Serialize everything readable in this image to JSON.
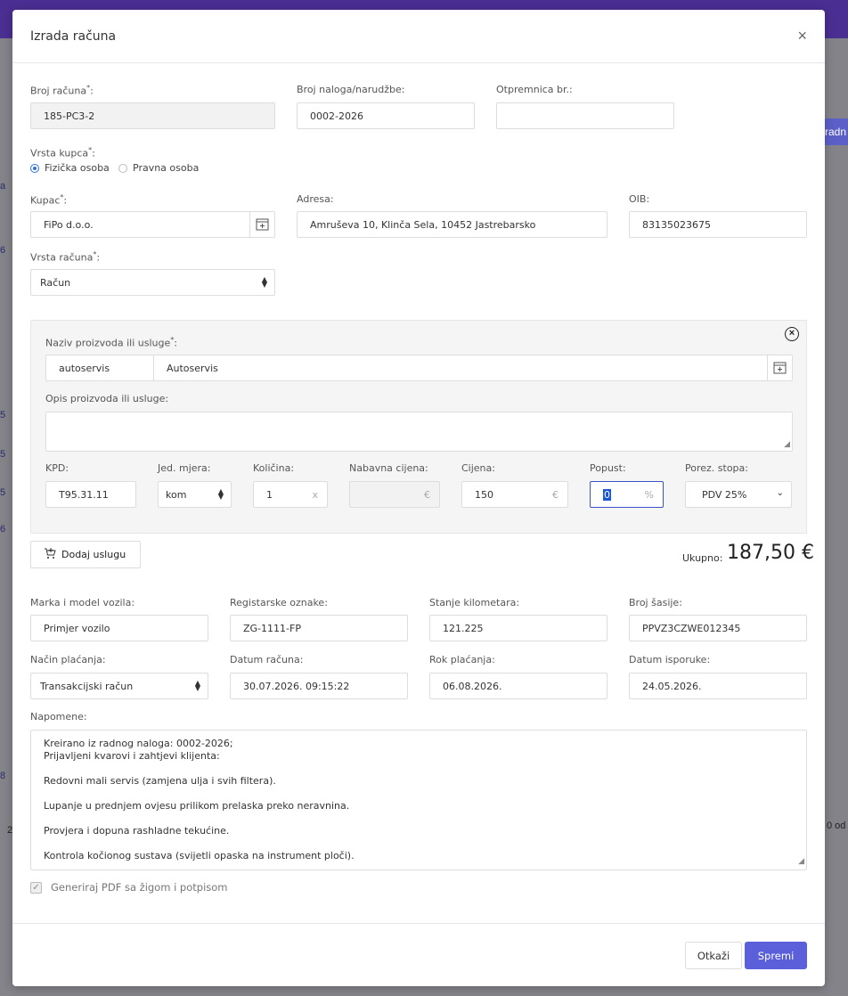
{
  "modal": {
    "title": "Izrada računa",
    "close_symbol": "×"
  },
  "fields": {
    "invoice_no_label": "Broj računa",
    "invoice_no_value": "185-PC3-2",
    "order_no_label": "Broj naloga/narudžbe:",
    "order_no_value": "0002-2026",
    "delivery_note_label": "Otpremnica br.:",
    "delivery_note_value": "",
    "customer_type_label": "Vrsta kupca",
    "customer_type_options": [
      "Fizička osoba",
      "Pravna osoba"
    ],
    "customer_type_selected": "Fizička osoba",
    "customer_label": "Kupac",
    "customer_value": "FiPo d.o.o.",
    "address_label": "Adresa:",
    "address_value": "Amruševa 10, Klinča Sela, 10452 Jastrebarsko",
    "oib_label": "OIB:",
    "oib_value": "83135023675",
    "invoice_type_label": "Vrsta računa",
    "invoice_type_value": "Račun"
  },
  "product": {
    "name_label": "Naziv proizvoda ili usluge",
    "code_value": "autoservis",
    "name_value": "Autoservis",
    "desc_label": "Opis proizvoda ili usluge:",
    "desc_value": "",
    "kpd_label": "KPD:",
    "kpd_value": "T95.31.11",
    "unit_label": "Jed. mjera:",
    "unit_value": "kom",
    "qty_label": "Količina:",
    "qty_value": "1",
    "qty_suffix": "x",
    "purchase_label": "Nabavna cijena:",
    "purchase_value": "",
    "currency_suffix": "€",
    "price_label": "Cijena:",
    "price_value": "150",
    "discount_label": "Popust:",
    "discount_value": "0",
    "percent_suffix": "%",
    "tax_label": "Porez. stopa:",
    "tax_value": "PDV 25%"
  },
  "actions": {
    "add_service": "Dodaj uslugu",
    "total_label": "Ukupno:",
    "total_value": "187,50 €"
  },
  "vehicle": {
    "model_label": "Marka i model vozila:",
    "model_value": "Primjer vozilo",
    "plate_label": "Registarske oznake:",
    "plate_value": "ZG-1111-FP",
    "km_label": "Stanje kilometara:",
    "km_value": "121.225",
    "vin_label": "Broj šasije:",
    "vin_value": "PPVZ3CZWE012345"
  },
  "payment": {
    "method_label": "Način plaćanja:",
    "method_value": "Transakcijski račun",
    "date_label": "Datum računa:",
    "date_value": "30.07.2026. 09:15:22",
    "due_label": "Rok plaćanja:",
    "due_value": "06.08.2026.",
    "delivery_label": "Datum isporuke:",
    "delivery_value": "24.05.2026."
  },
  "notes": {
    "label": "Napomene:",
    "lines": [
      "Kreirano iz radnog naloga: 0002-2026;",
      "Prijavljeni kvarovi i zahtjevi klijenta:",
      "Redovni mali servis (zamjena ulja i svih filtera).",
      "Lupanje u prednjem ovjesu prilikom prelaska preko neravnina.",
      "Provjera i dopuna rashladne tekućine.",
      "Kontrola kočionog sustava (svijetli opaska na instrument ploči)."
    ]
  },
  "pdf_checkbox_label": "Generiraj PDF sa žigom i potpisom",
  "footer": {
    "cancel": "Otkaži",
    "save": "Spremi"
  },
  "background": {
    "button_fragment": "radn",
    "left_fragments": [
      "a",
      "6",
      "5",
      "5",
      "5",
      "6",
      "8",
      "2"
    ],
    "right_fragment": "0 od"
  },
  "colors": {
    "topbar": "#4a2e91",
    "primary": "#5b5fd9",
    "focus": "#3b52c4"
  }
}
